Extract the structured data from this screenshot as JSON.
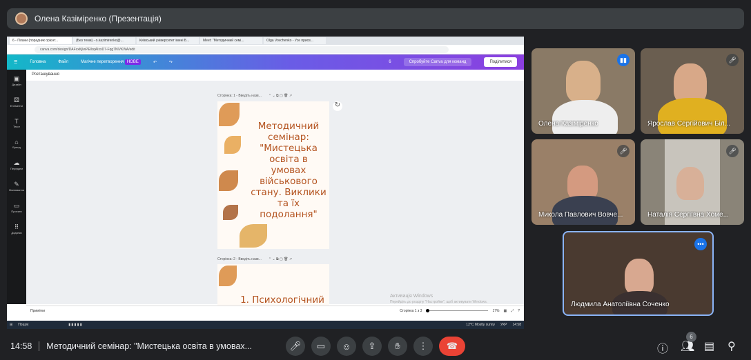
{
  "presenter_bar": {
    "title": "Олена Казіміренко (Презентація)"
  },
  "shared_screen": {
    "browser_tabs": [
      "6 - Плани (порадник орієнт...",
      "(Без теми) - o.kazimirenko@...",
      "Київський університет імені Б...",
      "Meet: \"Методичний семі...",
      "Olga Vovchenko - Усе присв..."
    ],
    "url": "canva.com/design/DAFxxKjIwPE/bqAIxxD7-Fqg7NlVKWA/edit",
    "canva_toolbar": {
      "home": "Головна",
      "file": "Файл",
      "magic": "Магічне перетворення",
      "magic_badge": "НОВЕ",
      "count": "6",
      "try": "Спробуйте Canva для команд",
      "share": "Поділитися"
    },
    "sidebar": [
      "Дизайн",
      "Елементи",
      "Текст",
      "Бренд",
      "Передати",
      "Малювання",
      "Проєкти",
      "Додатки"
    ],
    "layout_label": "Розташування",
    "pages": [
      {
        "header": "Сторінка: 1 - Введіть назв...",
        "text": "Методичний семінар: \"Мистецька освіта в умовах військового стану. Виклики та їх подолання\""
      },
      {
        "header": "Сторінка: 2 - Введіть назв...",
        "text": "1. Психологічний"
      }
    ],
    "watermark": [
      "Активація Windows",
      "Перейдіть до розділу \"Настройки\", щоб активувати Windows."
    ],
    "status": {
      "notes": "Примітки",
      "page": "Сторінка 1 з 3",
      "zoom": "17%"
    },
    "taskbar": {
      "search": "Пошук",
      "weather": "12°C  Mostly sunny",
      "lang": "УКР",
      "time": "14:58"
    }
  },
  "participants": [
    {
      "name": "Олена Казіміренко",
      "speaking": true
    },
    {
      "name": "Ярослав Сергійович Біл...",
      "muted": true
    },
    {
      "name": "Микола Павлович Вовче...",
      "muted": true
    },
    {
      "name": "Наталія Сергіївна Хоме...",
      "muted": true
    },
    {
      "name": "Людмила Анатоліївна Соченко",
      "self": true
    }
  ],
  "bottom": {
    "time": "14:58",
    "meeting_title": "Методичний семінар: \"Мистецька освіта в умовах...",
    "participant_count": "6"
  },
  "colors": {
    "background": "#202124",
    "end_call": "#ea4335",
    "accent": "#1a73e8"
  }
}
